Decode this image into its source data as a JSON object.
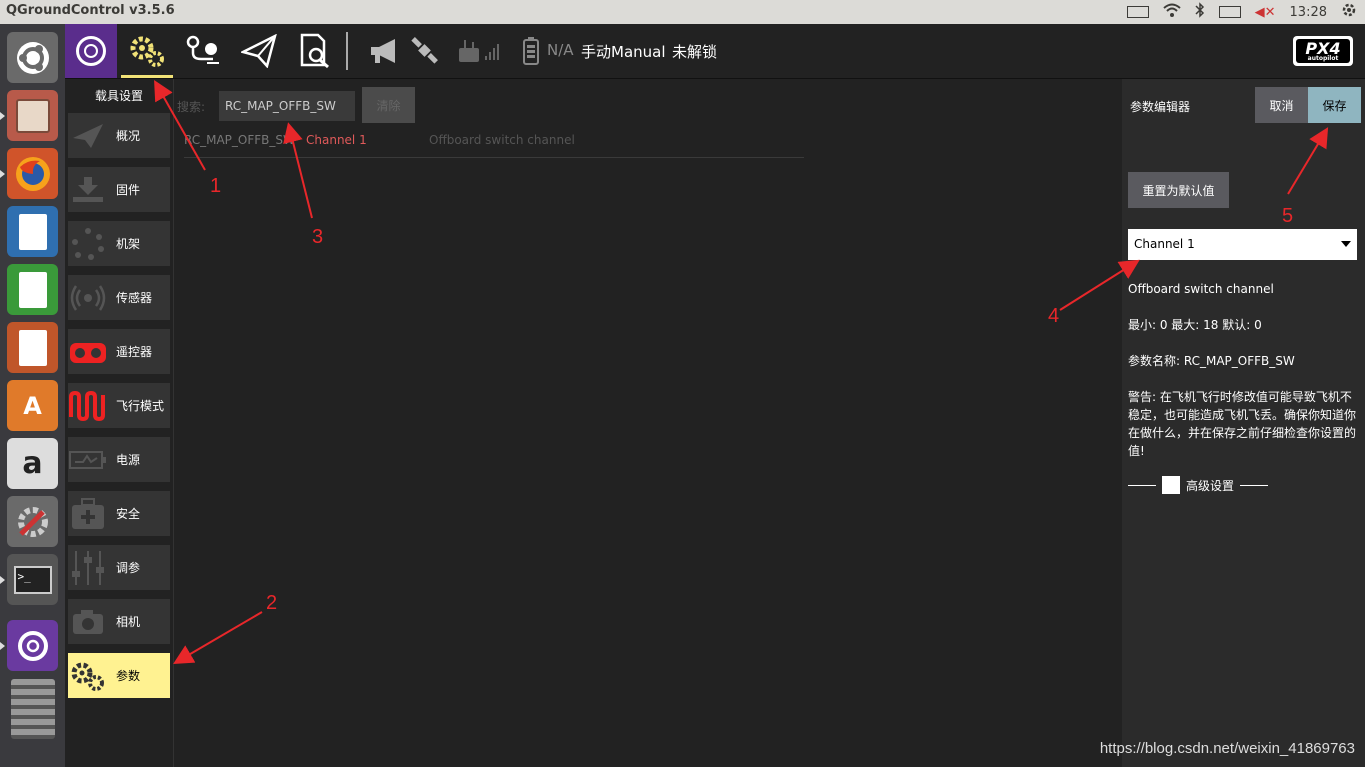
{
  "topbar": {
    "app_title": "QGroundControl v3.5.6",
    "clock": "13:28"
  },
  "launcher": {
    "icons": [
      "ubuntu-dash-icon",
      "files-icon",
      "firefox-icon",
      "writer-icon",
      "calc-icon",
      "impress-icon",
      "software-center-icon",
      "amazon-icon",
      "system-settings-icon",
      "terminal-icon",
      "qgroundcontrol-icon",
      "workspace-switcher-icon"
    ]
  },
  "toolbar": {
    "status_na": "N/A",
    "flight_mode": "手动Manual",
    "armed_state": "未解锁",
    "brand": "PX4",
    "brand_sub": "autopilot"
  },
  "sidebar": {
    "header": "载具设置",
    "items": [
      {
        "label": "概况",
        "icon": "paper-plane-icon"
      },
      {
        "label": "固件",
        "icon": "firmware-download-icon"
      },
      {
        "label": "机架",
        "icon": "airframe-icon"
      },
      {
        "label": "传感器",
        "icon": "sensors-icon"
      },
      {
        "label": "遥控器",
        "icon": "radio-icon"
      },
      {
        "label": "飞行模式",
        "icon": "flight-modes-icon"
      },
      {
        "label": "电源",
        "icon": "battery-icon"
      },
      {
        "label": "安全",
        "icon": "safety-icon"
      },
      {
        "label": "调参",
        "icon": "tuning-sliders-icon"
      },
      {
        "label": "相机",
        "icon": "camera-icon"
      },
      {
        "label": "参数",
        "icon": "parameters-gears-icon"
      }
    ]
  },
  "params": {
    "search_label": "搜索:",
    "search_value": "RC_MAP_OFFB_SW",
    "clear_label": "清除",
    "row": {
      "name": "RC_MAP_OFFB_SW",
      "value": "Channel 1",
      "description": "Offboard switch channel"
    }
  },
  "editor": {
    "title": "参数编辑器",
    "cancel_label": "取消",
    "save_label": "保存",
    "reset_label": "重置为默认值",
    "selected_value": "Channel 1",
    "description": "Offboard switch channel",
    "range": "最小: 0 最大: 18 默认: 0",
    "param_name": "参数名称: RC_MAP_OFFB_SW",
    "warning": "警告: 在飞机飞行时修改值可能导致飞机不稳定，也可能造成飞机飞丢。确保你知道你在做什么，并在保存之前仔细检查你设置的值!",
    "advanced_label": "高级设置"
  },
  "annotations": [
    "1",
    "2",
    "3",
    "4",
    "5"
  ],
  "watermark": "https://blog.csdn.net/weixin_41869763",
  "colors": {
    "active_tab": "#fff291",
    "logo_bg": "#5a2d8c",
    "save_bg": "#8fb5c0",
    "annotation": "#e8272a",
    "param_value": "#e05a5a"
  }
}
